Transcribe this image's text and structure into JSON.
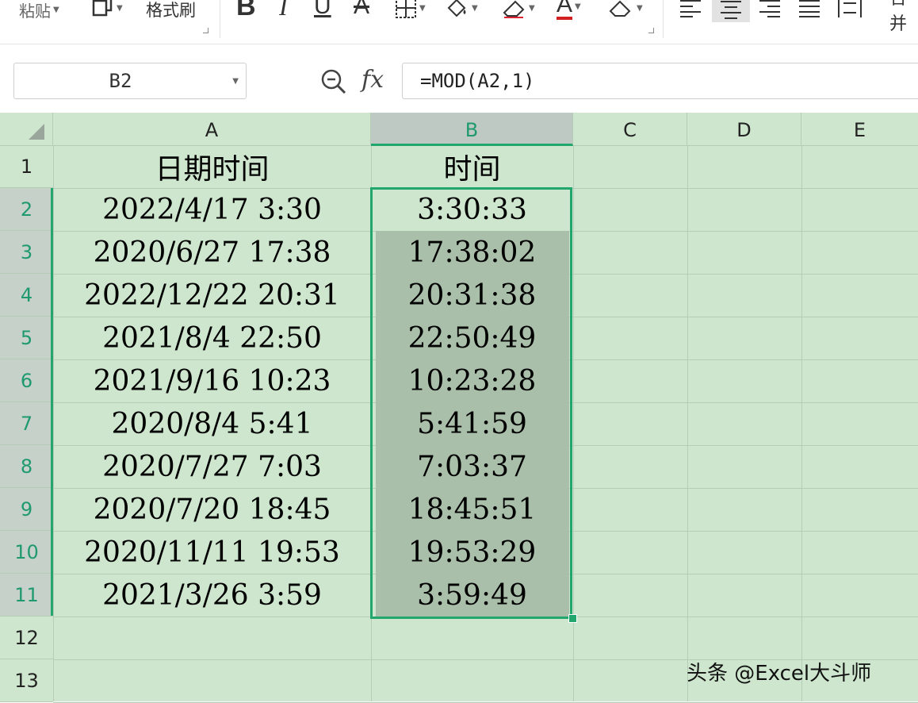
{
  "ribbon": {
    "paste_label": "粘贴",
    "format_painter_label": "格式刷",
    "merge_label": "合并"
  },
  "name_box": {
    "value": "B2"
  },
  "formula_bar": {
    "formula": "=MOD(A2,1)"
  },
  "columns": [
    "A",
    "B",
    "C",
    "D",
    "E"
  ],
  "selected_column": "B",
  "rows": [
    "1",
    "2",
    "3",
    "4",
    "5",
    "6",
    "7",
    "8",
    "9",
    "10",
    "11",
    "12",
    "13"
  ],
  "headers": {
    "a": "日期时间",
    "b": "时间"
  },
  "data": [
    {
      "datetime": "2022/4/17 3:30",
      "time": "3:30:33"
    },
    {
      "datetime": "2020/6/27 17:38",
      "time": "17:38:02"
    },
    {
      "datetime": "2022/12/22 20:31",
      "time": "20:31:38"
    },
    {
      "datetime": "2021/8/4 22:50",
      "time": "22:50:49"
    },
    {
      "datetime": "2021/9/16 10:23",
      "time": "10:23:28"
    },
    {
      "datetime": "2020/8/4 5:41",
      "time": "5:41:59"
    },
    {
      "datetime": "2020/7/27 7:03",
      "time": "7:03:37"
    },
    {
      "datetime": "2020/7/20 18:45",
      "time": "18:45:51"
    },
    {
      "datetime": "2020/11/11 19:53",
      "time": "19:53:29"
    },
    {
      "datetime": "2021/3/26 3:59",
      "time": "3:59:49"
    }
  ],
  "watermark": "头条 @Excel大斗师",
  "colors": {
    "accent": "#21a66e",
    "sheet_bg": "#cde6cd",
    "selection_fill": "#aabfaa"
  }
}
